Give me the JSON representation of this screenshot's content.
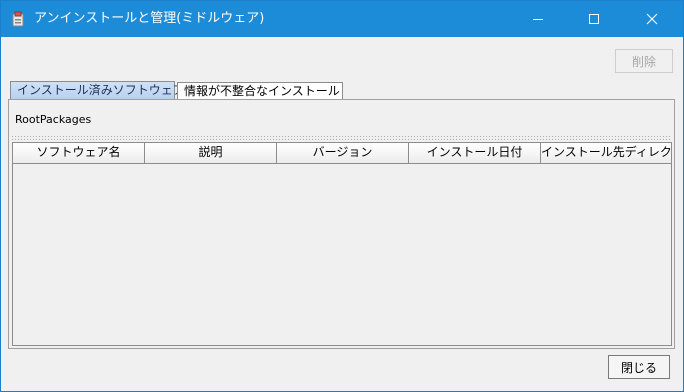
{
  "window": {
    "title": "アンインストールと管理(ミドルウェア)",
    "icon": "installer-icon",
    "controls": [
      "minimize-icon",
      "maximize-icon",
      "close-icon"
    ]
  },
  "toolbar": {
    "delete_label": "削除",
    "delete_enabled": false
  },
  "tabs": [
    {
      "label": "インストール済みソフトウェア",
      "selected": true
    },
    {
      "label": "情報が不整合なインストール",
      "selected": false
    }
  ],
  "main": {
    "root_label": "RootPackages",
    "columns": [
      "ソフトウェア名",
      "説明",
      "バージョン",
      "インストール日付",
      "インストール先ディレクト…"
    ],
    "rows": []
  },
  "footer": {
    "close_label": "閉じる"
  },
  "colors": {
    "titlebar": "#1c8bd8",
    "selected_tab": "#c4d9f2"
  }
}
